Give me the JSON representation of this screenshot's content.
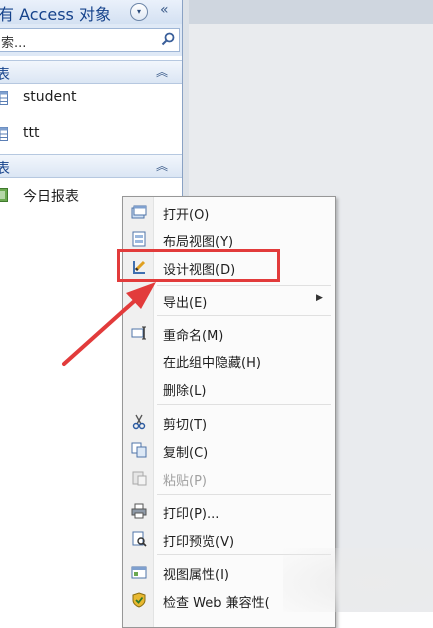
{
  "nav": {
    "title": "有 Access 对象",
    "dropdown_glyph": "▾",
    "collapse_glyph": "«",
    "search": {
      "value": "索..."
    },
    "groups": [
      {
        "label": "表",
        "chevron": "︽",
        "items": [
          {
            "label": "student",
            "icon": "table-icon"
          },
          {
            "label": "ttt",
            "icon": "table-icon"
          }
        ]
      },
      {
        "label": "表",
        "chevron": "︽",
        "items": [
          {
            "label": "今日报表",
            "icon": "report-icon"
          }
        ]
      }
    ]
  },
  "context_menu": {
    "items": [
      {
        "label": "打开(O)",
        "icon": "open-icon"
      },
      {
        "label": "布局视图(Y)",
        "icon": "layout-view-icon"
      },
      {
        "label": "设计视图(D)",
        "icon": "design-view-icon"
      },
      {
        "label": "导出(E)",
        "submenu_arrow": "▶"
      },
      {
        "label": "重命名(M)",
        "icon": "rename-icon"
      },
      {
        "label": "在此组中隐藏(H)"
      },
      {
        "label": "删除(L)"
      },
      {
        "label": "剪切(T)",
        "icon": "cut-icon"
      },
      {
        "label": "复制(C)",
        "icon": "copy-icon"
      },
      {
        "label": "粘贴(P)",
        "icon": "paste-icon",
        "disabled": true
      },
      {
        "label": "打印(P)...",
        "icon": "print-icon"
      },
      {
        "label": "打印预览(V)",
        "icon": "print-preview-icon"
      },
      {
        "label": "视图属性(I)",
        "icon": "properties-icon"
      },
      {
        "label": "检查 Web 兼容性(",
        "icon": "web-check-icon"
      }
    ]
  },
  "colors": {
    "annotation": "#e23b3b",
    "nav_text": "#15428b"
  }
}
